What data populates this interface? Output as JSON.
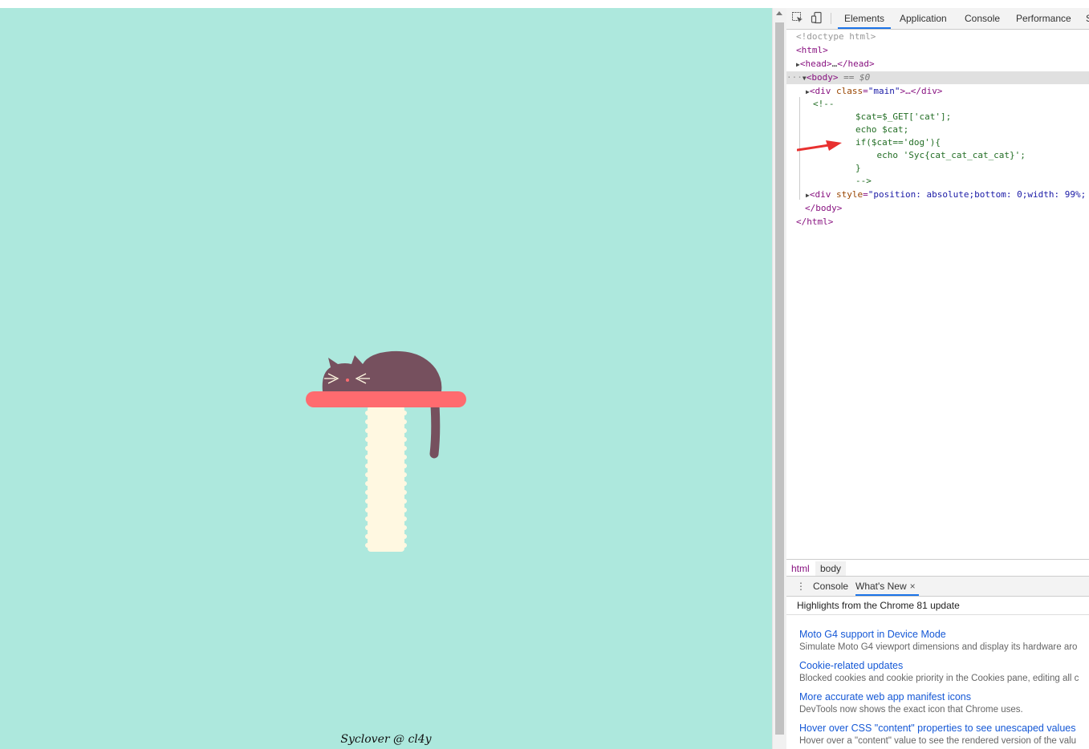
{
  "page": {
    "footer": "Syclover @ cl4y",
    "background_color": "#ade8dd"
  },
  "devtools": {
    "toolbar_icons": [
      "inspect-element-icon",
      "device-toolbar-icon"
    ],
    "tabs": [
      "Elements",
      "Application",
      "Console",
      "Performance",
      "S"
    ],
    "active_tab": "Elements",
    "dom": {
      "doctype": "<!doctype html>",
      "html_open": "<html>",
      "head_open": "<head>",
      "head_ellipsis": "…",
      "head_close": "</head>",
      "body_open": "<body>",
      "body_marker": "== $0",
      "div_main_open": "<div ",
      "div_main_attr": "class",
      "div_main_val": "\"main\"",
      "div_main_rest": ">…</div>",
      "comment_open": "<!--",
      "code_lines": [
        "$cat=$_GET['cat'];",
        "echo $cat;",
        "if($cat=='dog'){",
        "    echo 'Syc{cat_cat_cat_cat}';",
        "}",
        "-->"
      ],
      "div_style_open": "<div ",
      "div_style_attr": "style",
      "div_style_val": "\"position: absolute;bottom: 0;width: 99%;",
      "body_close": "</body>",
      "html_close": "</html>"
    },
    "breadcrumbs": [
      "html",
      "body"
    ],
    "drawer": {
      "tabs": [
        "Console",
        "What's New"
      ],
      "active_tab": "What's New",
      "close_glyph": "×",
      "header": "Highlights from the Chrome 81 update",
      "items": [
        {
          "title": "Moto G4 support in Device Mode",
          "desc": "Simulate Moto G4 viewport dimensions and display its hardware aro"
        },
        {
          "title": "Cookie-related updates",
          "desc": "Blocked cookies and cookie priority in the Cookies pane, editing all c"
        },
        {
          "title": "More accurate web app manifest icons",
          "desc": "DevTools now shows the exact icon that Chrome uses."
        },
        {
          "title": "Hover over CSS \"content\" properties to see unescaped values",
          "desc": "Hover over a \"content\" value to see the rendered version of the valu"
        }
      ]
    }
  },
  "colors": {
    "cat": "#76505e",
    "shelf": "#ff6b6f",
    "post": "#fff8e1",
    "arrow": "#e8302f",
    "accent": "#1a73e8"
  }
}
